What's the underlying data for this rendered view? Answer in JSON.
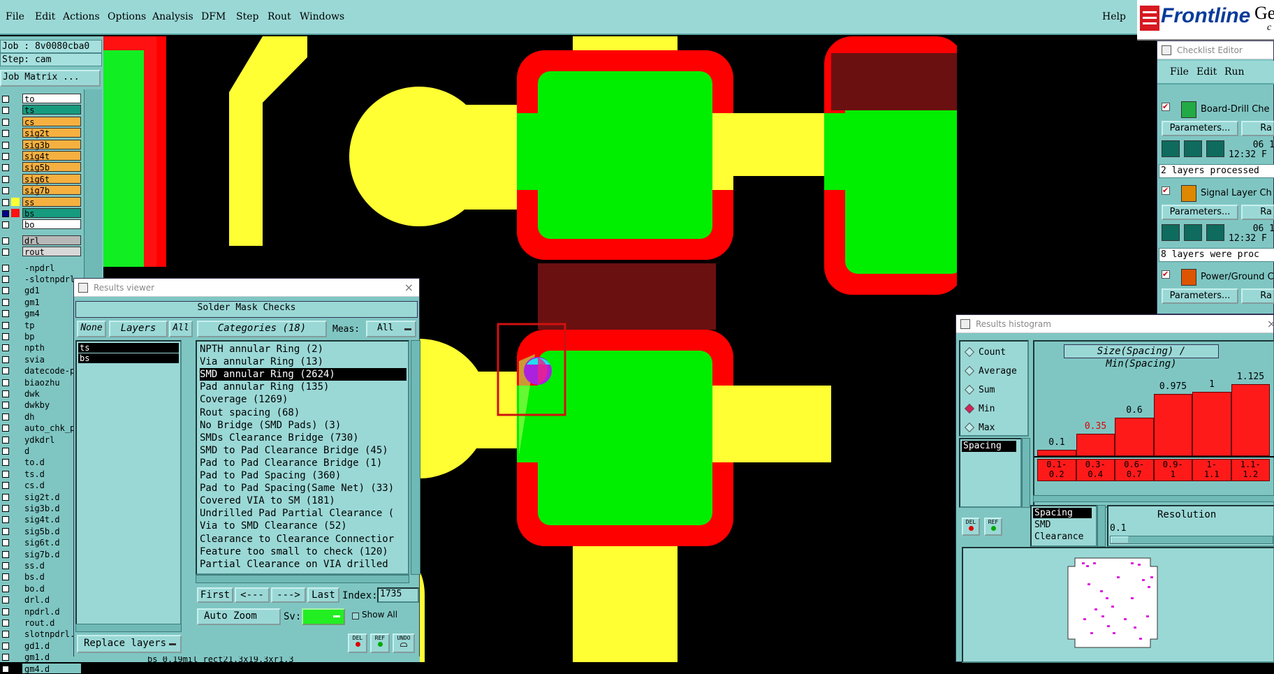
{
  "menubar": {
    "items": [
      "File",
      "Edit",
      "Actions",
      "Options",
      "Analysis",
      "DFM",
      "Step",
      "Rout",
      "Windows"
    ],
    "help": "Help"
  },
  "logo": {
    "brand": "Frontline",
    "suffix": "Ge",
    "sub": "c"
  },
  "left": {
    "job": "Job : 8v0080cba0",
    "step": "Step: cam",
    "job_matrix": "Job Matrix ...",
    "board_layers": [
      {
        "name": "to",
        "color": "#ffffff"
      },
      {
        "name": "ts",
        "color": "#169b7f"
      },
      {
        "name": "cs",
        "color": "#f5b040"
      },
      {
        "name": "sig2t",
        "color": "#f5b040"
      },
      {
        "name": "sig3b",
        "color": "#f5b040"
      },
      {
        "name": "sig4t",
        "color": "#f5b040"
      },
      {
        "name": "sig5b",
        "color": "#f5b040"
      },
      {
        "name": "sig6t",
        "color": "#f5b040"
      },
      {
        "name": "sig7b",
        "color": "#f5b040"
      },
      {
        "name": "ss",
        "color": "#f5b040"
      },
      {
        "name": "bs",
        "color": "#169b7f"
      },
      {
        "name": "bo",
        "color": "#ffffff"
      }
    ],
    "drill_layers": [
      {
        "name": "drl",
        "color": "#b8b8b8"
      },
      {
        "name": "rout",
        "color": "#d8d8d8"
      }
    ],
    "misc_layers": [
      "-npdrl",
      "-slotnpdrl",
      "gd1",
      "gm1",
      "gm4",
      "tp",
      "bp",
      "npth",
      "svia",
      "datecode-p",
      "biaozhu",
      "dwk",
      "dwkby",
      "dh",
      "auto_chk_p",
      "ydkdrl",
      "d",
      "to.d",
      "ts.d",
      "cs.d",
      "sig2t.d",
      "sig3b.d",
      "sig4t.d",
      "sig5b.d",
      "sig6t.d",
      "sig7b.d",
      "ss.d",
      "bs.d",
      "bo.d",
      "drl.d",
      "npdrl.d",
      "rout.d",
      "slotnpdrl.",
      "gd1.d",
      "gm1.d",
      "gm4.d"
    ]
  },
  "results_viewer": {
    "title": "Results viewer",
    "heading": "Solder Mask Checks",
    "none_btn": "None",
    "layers_btn": "Layers",
    "all_btn": "All",
    "layers": [
      "ts",
      "bs"
    ],
    "categories_btn": "Categories (18)",
    "meas_label": "Meas:",
    "meas_value": "All",
    "categories": [
      "NPTH annular Ring (2)",
      "Via annular Ring (13)",
      "SMD annular Ring (2624)",
      "Pad annular Ring (135)",
      "Coverage (1269)",
      "Rout spacing (68)",
      "No Bridge (SMD Pads) (3)",
      "SMDs Clearance Bridge (730)",
      "SMD to Pad Clearance Bridge (45)",
      "Pad to Pad Clearance Bridge (1)",
      "Pad to Pad Spacing (360)",
      "Pad to Pad Spacing(Same Net) (33)",
      "Covered VIA to SM (181)",
      "Undrilled Pad Partial Clearance (",
      "Via to SMD Clearance (52)",
      "Clearance to Clearance Connectior",
      "Feature too small to check (120)",
      "Partial Clearance on VIA drilled"
    ],
    "selected_category": 2,
    "first": "First",
    "prev": "<---",
    "next": "--->",
    "last": "Last",
    "index_label": "Index:",
    "index_value": "1735",
    "auto_zoom": "Auto Zoom",
    "sv_label": "Sv:",
    "show_all": "Show All",
    "replace_layers": "Replace layers",
    "del": "DEL",
    "ref": "REF",
    "undo": "UNDO",
    "status": "bs 0.19mil  rect21.3x19.3xr1.3"
  },
  "checklist": {
    "title": "Checklist Editor",
    "menu": [
      "File",
      "Edit",
      "Run"
    ],
    "items": [
      {
        "name": "Board-Drill Che",
        "params": "Parameters...",
        "ra": "Ra",
        "date": "06 1",
        "time": "12:32 F",
        "note": "2 layers processed"
      },
      {
        "name": "Signal Layer Ch",
        "params": "Parameters...",
        "ra": "Ra",
        "date": "06 1",
        "time": "12:32 F",
        "note": "8 layers were proc"
      },
      {
        "name": "Power/Ground C",
        "params": "Parameters...",
        "ra": "Ra"
      }
    ]
  },
  "histogram": {
    "title": "Results histogram",
    "options": [
      "Count",
      "Average",
      "Sum",
      "Min",
      "Max"
    ],
    "selected_option": "Min",
    "header": "Size(Spacing) / Min(Spacing)",
    "measure": "Spacing",
    "list": [
      "Spacing",
      "SMD",
      "Clearance"
    ],
    "resolution_label": "Resolution",
    "resolution_value": "0.1",
    "del": "DEL",
    "ref": "REF"
  },
  "chart_data": {
    "type": "bar",
    "categories": [
      "0.1-0.2",
      "0.3-0.4",
      "0.6-0.7",
      "0.9-1",
      "1-1.1",
      "1.1-1.2"
    ],
    "bin_lines": [
      [
        "0.1-",
        "0.2"
      ],
      [
        "0.3-",
        "0.4"
      ],
      [
        "0.6-",
        "0.7"
      ],
      [
        "0.9-",
        "1"
      ],
      [
        "1-",
        "1.1"
      ],
      [
        "1.1-",
        "1.2"
      ]
    ],
    "values": [
      0.1,
      0.35,
      0.6,
      0.975,
      1,
      1.125
    ],
    "labels": [
      "0.1",
      "0.35",
      "0.6",
      "0.975",
      "1",
      "1.125"
    ],
    "highlight": 1,
    "ylim": [
      0,
      1.2
    ],
    "bar_color": "#ff1a1a"
  }
}
